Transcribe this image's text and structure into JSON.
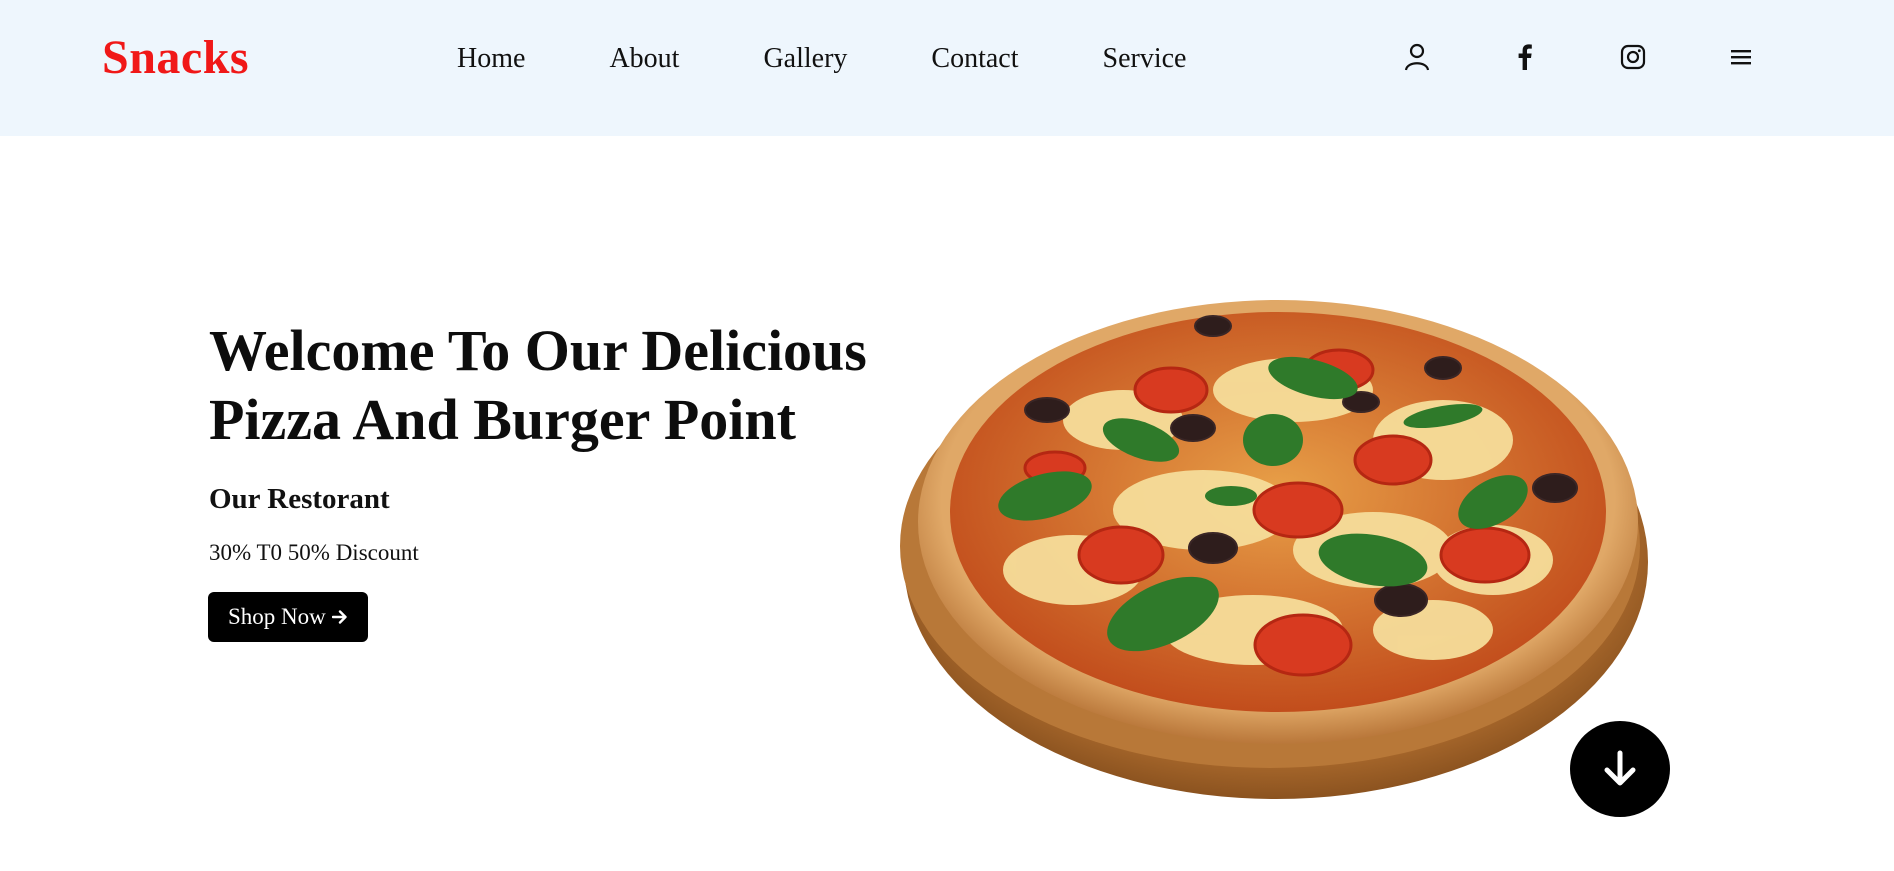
{
  "header": {
    "logo": "Snacks",
    "nav": [
      {
        "label": "Home"
      },
      {
        "label": "About"
      },
      {
        "label": "Gallery"
      },
      {
        "label": "Contact"
      },
      {
        "label": "Service"
      }
    ],
    "icons": [
      "user-icon",
      "facebook-icon",
      "instagram-icon",
      "menu-icon"
    ]
  },
  "hero": {
    "title_line1": "Welcome To Our Delicious",
    "title_line2": "Pizza And Burger Point",
    "subtitle": "Our Restorant",
    "discount": "30% T0 50% Discount",
    "cta_label": "Shop Now",
    "cta_icon": "arrow-right-icon",
    "image": "pizza-image",
    "scroll_icon": "arrow-down-icon"
  },
  "colors": {
    "header_bg": "#eef6fd",
    "logo": "#f01818",
    "button_bg": "#000000",
    "button_text": "#ffffff"
  }
}
